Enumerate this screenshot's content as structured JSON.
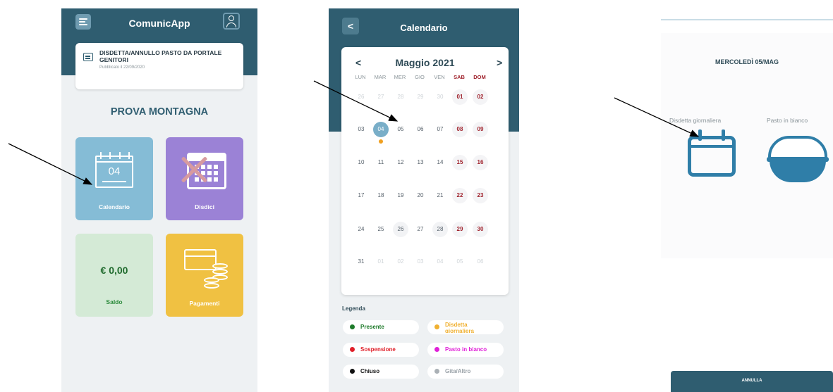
{
  "phone1": {
    "app_title": "ComunicApp",
    "news": {
      "title": "DISDETTA/ANNULLO PASTO DA PORTALE GENITORI",
      "date": "Pubblicato il 22/09/2020"
    },
    "school_name": "PROVA MONTAGNA",
    "tiles": {
      "calendar_label": "Calendario",
      "calendar_day": "04",
      "disdici_label": "Disdici",
      "saldo_amount": "€ 0,00",
      "saldo_label": "Saldo",
      "pagamenti_label": "Pagamenti"
    },
    "colors": {
      "header": "#2f5d70",
      "calendar_tile": "#85bcd6",
      "disdici_tile": "#9b82d6",
      "saldo_tile": "#d4ead6",
      "pagamenti_tile": "#f0c142"
    },
    "icons": [
      "menu-icon",
      "user-icon",
      "news-icon",
      "calendar-icon",
      "calendar-cancel-icon",
      "payments-icon"
    ]
  },
  "phone2": {
    "title": "Calendario",
    "back_label": "<",
    "month": "Maggio 2021",
    "prev_label": "<",
    "next_label": ">",
    "weekdays": [
      "LUN",
      "MAR",
      "MER",
      "GIO",
      "VEN",
      "SAB",
      "DOM"
    ],
    "weeks": [
      [
        "26",
        "27",
        "28",
        "29",
        "30",
        "01",
        "02"
      ],
      [
        "03",
        "04",
        "05",
        "06",
        "07",
        "08",
        "09"
      ],
      [
        "10",
        "11",
        "12",
        "13",
        "14",
        "15",
        "16"
      ],
      [
        "17",
        "18",
        "19",
        "20",
        "21",
        "22",
        "23"
      ],
      [
        "24",
        "25",
        "26",
        "27",
        "28",
        "29",
        "30"
      ],
      [
        "31",
        "01",
        "02",
        "03",
        "04",
        "05",
        "06"
      ]
    ],
    "selected_day": "04",
    "legend_title": "Legenda",
    "legend": [
      {
        "label": "Presente",
        "color": "#1e7a2a"
      },
      {
        "label": "Disdetta giornaliera",
        "color": "#f0b030"
      },
      {
        "label": "Sospensione",
        "color": "#e0202a"
      },
      {
        "label": "Pasto in bianco",
        "color": "#e020d8"
      },
      {
        "label": "Chiuso",
        "color": "#111111"
      },
      {
        "label": "Gita/Altro",
        "color": "#aab0b5"
      }
    ]
  },
  "phone3": {
    "date_label": "MERCOLEDÌ 05/MAG",
    "option_left": "Disdetta giornaliera",
    "option_right": "Pasto in bianco",
    "footer_label": "ANNULLA",
    "icons": [
      "calendar-icon",
      "rice-bowl-icon"
    ]
  }
}
